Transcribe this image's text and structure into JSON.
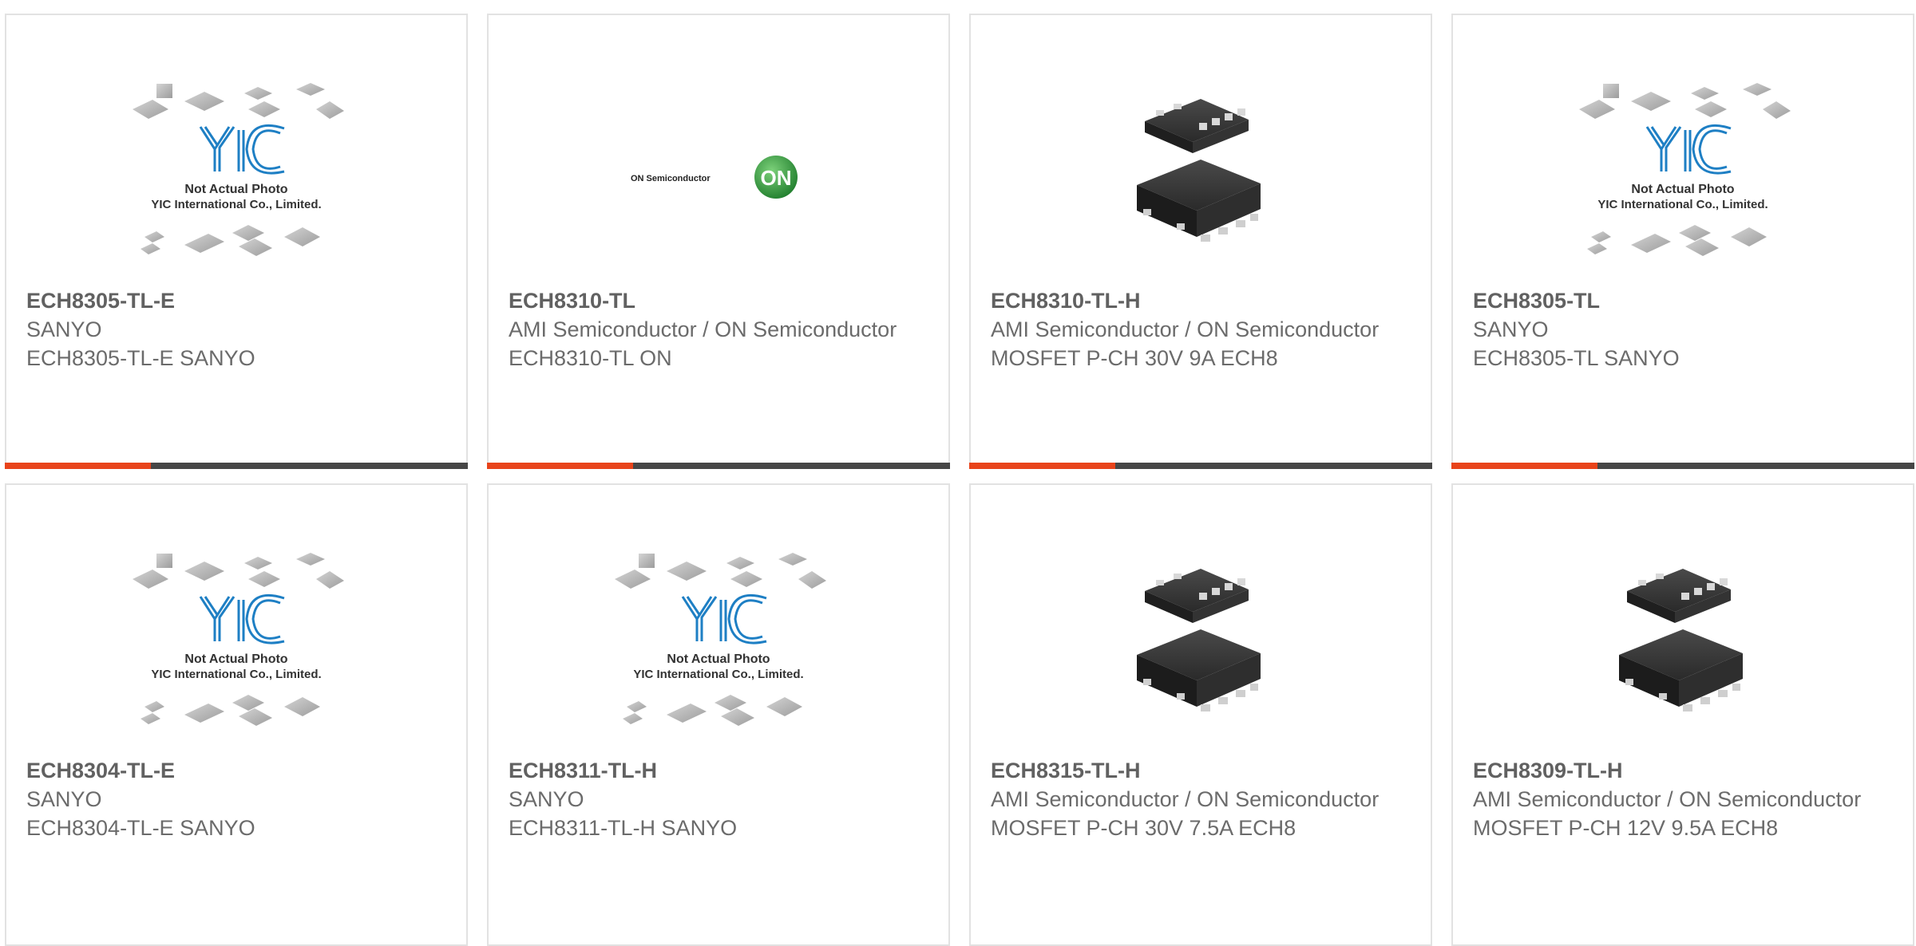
{
  "products": [
    {
      "part_number": "ECH8305-TL-E",
      "manufacturer": "SANYO",
      "description": "ECH8305-TL-E SANYO",
      "image": "yic-placeholder",
      "placeholder_caption_1": "Not Actual Photo",
      "placeholder_caption_2": "YIC International Co., Limited."
    },
    {
      "part_number": "ECH8310-TL",
      "manufacturer": "AMI Semiconductor / ON Semiconductor",
      "description": "ECH8310-TL ON",
      "image": "on-semiconductor-logo",
      "logo_text": "ON Semiconductor",
      "logo_mark": "ON"
    },
    {
      "part_number": "ECH8310-TL-H",
      "manufacturer": "AMI Semiconductor / ON Semiconductor",
      "description": "MOSFET P-CH 30V 9A ECH8",
      "image": "ech8-package-photo"
    },
    {
      "part_number": "ECH8305-TL",
      "manufacturer": "SANYO",
      "description": "ECH8305-TL SANYO",
      "image": "yic-placeholder",
      "placeholder_caption_1": "Not Actual Photo",
      "placeholder_caption_2": "YIC International Co., Limited."
    },
    {
      "part_number": "ECH8304-TL-E",
      "manufacturer": "SANYO",
      "description": "ECH8304-TL-E SANYO",
      "image": "yic-placeholder",
      "placeholder_caption_1": "Not Actual Photo",
      "placeholder_caption_2": "YIC International Co., Limited."
    },
    {
      "part_number": "ECH8311-TL-H",
      "manufacturer": "SANYO",
      "description": "ECH8311-TL-H SANYO",
      "image": "yic-placeholder",
      "placeholder_caption_1": "Not Actual Photo",
      "placeholder_caption_2": "YIC International Co., Limited."
    },
    {
      "part_number": "ECH8315-TL-H",
      "manufacturer": "AMI Semiconductor / ON Semiconductor",
      "description": "MOSFET P-CH 30V 7.5A ECH8",
      "image": "ech8-package-photo"
    },
    {
      "part_number": "ECH8309-TL-H",
      "manufacturer": "AMI Semiconductor / ON Semiconductor",
      "description": "MOSFET P-CH 12V 9.5A ECH8",
      "image": "ech8-package-photo"
    }
  ],
  "colors": {
    "accent": "#e8431a",
    "bar": "#464646",
    "border": "#e2e2e2",
    "text": "#6b6b6b",
    "yic_blue": "#1e7fc4",
    "on_green": "#2f9a3a"
  }
}
